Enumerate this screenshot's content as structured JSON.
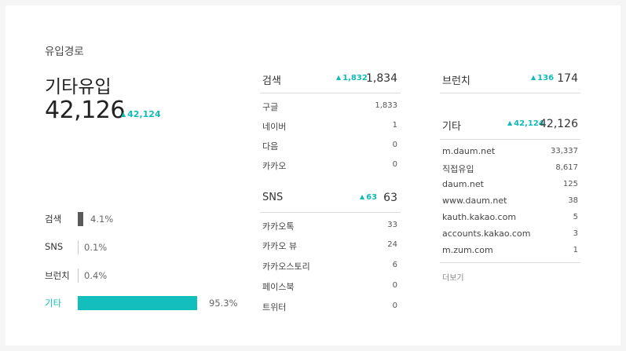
{
  "section_title": "유입경로",
  "main": {
    "label": "기타유입",
    "value": "42,126",
    "delta": "42,124"
  },
  "bars": [
    {
      "label": "검색",
      "pct": "4.1%",
      "value": 0.041,
      "active": false
    },
    {
      "label": "SNS",
      "pct": "0.1%",
      "value": 0.001,
      "active": false
    },
    {
      "label": "브런치",
      "pct": "0.4%",
      "value": 0.004,
      "active": false
    },
    {
      "label": "기타",
      "pct": "95.3%",
      "value": 0.953,
      "active": true
    }
  ],
  "columns": {
    "search": {
      "title": "검색",
      "delta": "1,832",
      "total": "1,834",
      "rows": [
        {
          "label": "구글",
          "value": "1,833"
        },
        {
          "label": "네이버",
          "value": "1"
        },
        {
          "label": "다음",
          "value": "0"
        },
        {
          "label": "카카오",
          "value": "0"
        }
      ]
    },
    "sns": {
      "title": "SNS",
      "delta": "63",
      "total": "63",
      "rows": [
        {
          "label": "카카오톡",
          "value": "33"
        },
        {
          "label": "카카오 뷰",
          "value": "24"
        },
        {
          "label": "카카오스토리",
          "value": "6"
        },
        {
          "label": "페이스북",
          "value": "0"
        },
        {
          "label": "트위터",
          "value": "0"
        }
      ]
    },
    "brunch": {
      "title": "브런치",
      "delta": "136",
      "total": "174"
    },
    "etc": {
      "title": "기타",
      "delta": "42,124",
      "total": "42,126",
      "rows": [
        {
          "label": "m.daum.net",
          "value": "33,337"
        },
        {
          "label": "직접유입",
          "value": "8,617"
        },
        {
          "label": "daum.net",
          "value": "125"
        },
        {
          "label": "www.daum.net",
          "value": "38"
        },
        {
          "label": "kauth.kakao.com",
          "value": "5"
        },
        {
          "label": "accounts.kakao.com",
          "value": "3"
        },
        {
          "label": "m.zum.com",
          "value": "1"
        }
      ],
      "more_label": "더보기"
    }
  },
  "colors": {
    "accent": "#13bfbd",
    "bar": "#5a5a5a"
  }
}
